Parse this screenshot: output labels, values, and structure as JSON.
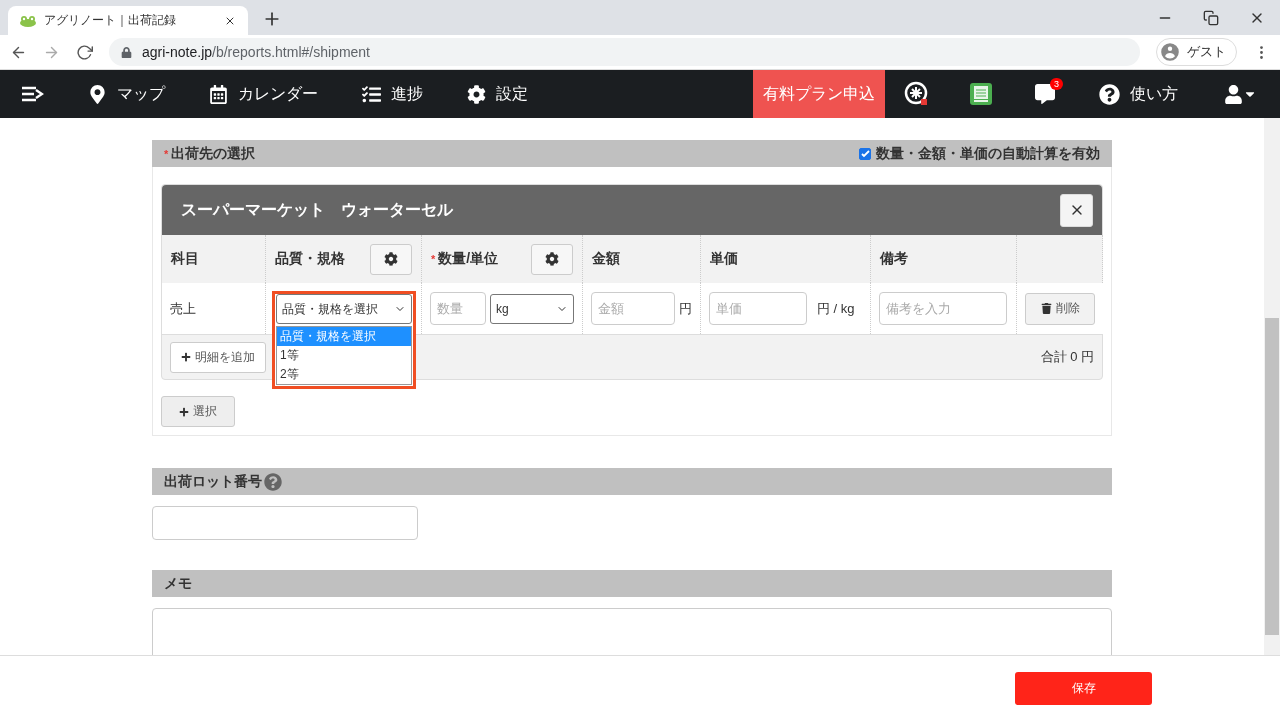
{
  "browser": {
    "tab_title": "アグリノート｜出荷記録",
    "url_host": "agri-note.jp",
    "url_path": "/b/reports.html#/shipment",
    "profile": "ゲスト"
  },
  "navbar": {
    "items": [
      {
        "kind": "map",
        "label": "マップ"
      },
      {
        "kind": "calendar",
        "label": "カレンダー"
      },
      {
        "kind": "progress",
        "label": "進捗"
      },
      {
        "kind": "settings",
        "label": "設定"
      }
    ],
    "plan_button": "有料プラン申込",
    "chat_badge": "3",
    "help": "使い方"
  },
  "destination": {
    "title": "出荷先の選択",
    "required_mark": "*",
    "auto_calc": {
      "label": "数量・金額・単価の自動計算を有効",
      "checked": true
    },
    "customer": {
      "name": "スーパーマーケット　ウォーターセル",
      "columns": [
        {
          "label": "科目",
          "settings": false
        },
        {
          "label": "品質・規格",
          "settings": true
        },
        {
          "label": "数量/単位",
          "required_mark": "*",
          "settings": true
        },
        {
          "label": "金額",
          "settings": false
        },
        {
          "label": "単価",
          "settings": false
        },
        {
          "label": "備考",
          "settings": false
        }
      ],
      "row": {
        "subject": "売上",
        "quality": "品質・規格を選択",
        "quality_options": [
          {
            "label": "品質・規格を選択",
            "selected": true
          },
          {
            "label": "1等",
            "selected": false
          },
          {
            "label": "2等",
            "selected": false
          }
        ],
        "quantity_placeholder": "数量",
        "unit": "kg",
        "amount_placeholder": "金額",
        "amount_unit": "円",
        "price_placeholder": "単価",
        "price_unit": "円 / kg",
        "note_placeholder": "備考を入力",
        "delete": "削除"
      },
      "add_line": "明細を追加",
      "total": "合計 0 円"
    },
    "select_button": "選択"
  },
  "lot": {
    "title": "出荷ロット番号"
  },
  "memo": {
    "title": "メモ"
  },
  "save": "保存"
}
